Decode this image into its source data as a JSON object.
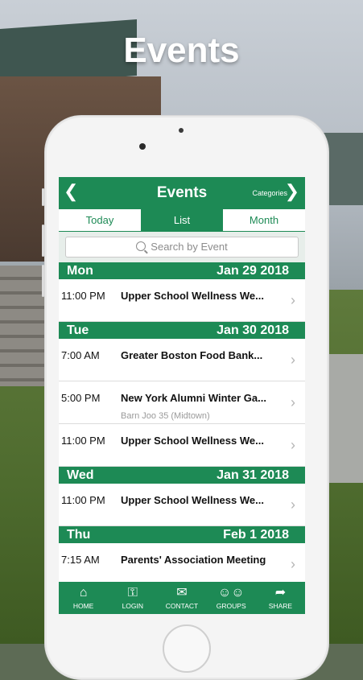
{
  "headline": "Events",
  "app": {
    "title": "Events",
    "categories_label": "Categories",
    "tabs": [
      {
        "label": "Today",
        "active": false
      },
      {
        "label": "List",
        "active": true
      },
      {
        "label": "Month",
        "active": false
      }
    ],
    "search_placeholder": "Search by Event",
    "days": [
      {
        "dow": "Mon",
        "date": "Jan 29 2018",
        "events": [
          {
            "time": "11:00 PM",
            "name": "Upper School Wellness We..."
          }
        ]
      },
      {
        "dow": "Tue",
        "date": "Jan 30 2018",
        "events": [
          {
            "time": "7:00 AM",
            "name": "Greater Boston Food Bank..."
          },
          {
            "time": "5:00 PM",
            "name": "New York Alumni Winter Ga...",
            "location": "Barn Joo 35 (Midtown)"
          },
          {
            "time": "11:00 PM",
            "name": "Upper School Wellness We..."
          }
        ]
      },
      {
        "dow": "Wed",
        "date": "Jan 31 2018",
        "events": [
          {
            "time": "11:00 PM",
            "name": "Upper School Wellness We..."
          }
        ]
      },
      {
        "dow": "Thu",
        "date": "Feb 1 2018",
        "events": [
          {
            "time": "7:15 AM",
            "name": "Parents' Association Meeting"
          }
        ]
      }
    ],
    "bottom_nav": [
      {
        "label": "HOME",
        "icon": "home-icon"
      },
      {
        "label": "LOGIN",
        "icon": "key-icon"
      },
      {
        "label": "CONTACT",
        "icon": "envelope-icon"
      },
      {
        "label": "GROUPS",
        "icon": "groups-icon"
      },
      {
        "label": "SHARE",
        "icon": "share-icon"
      }
    ],
    "colors": {
      "accent": "#1d8a55"
    }
  }
}
